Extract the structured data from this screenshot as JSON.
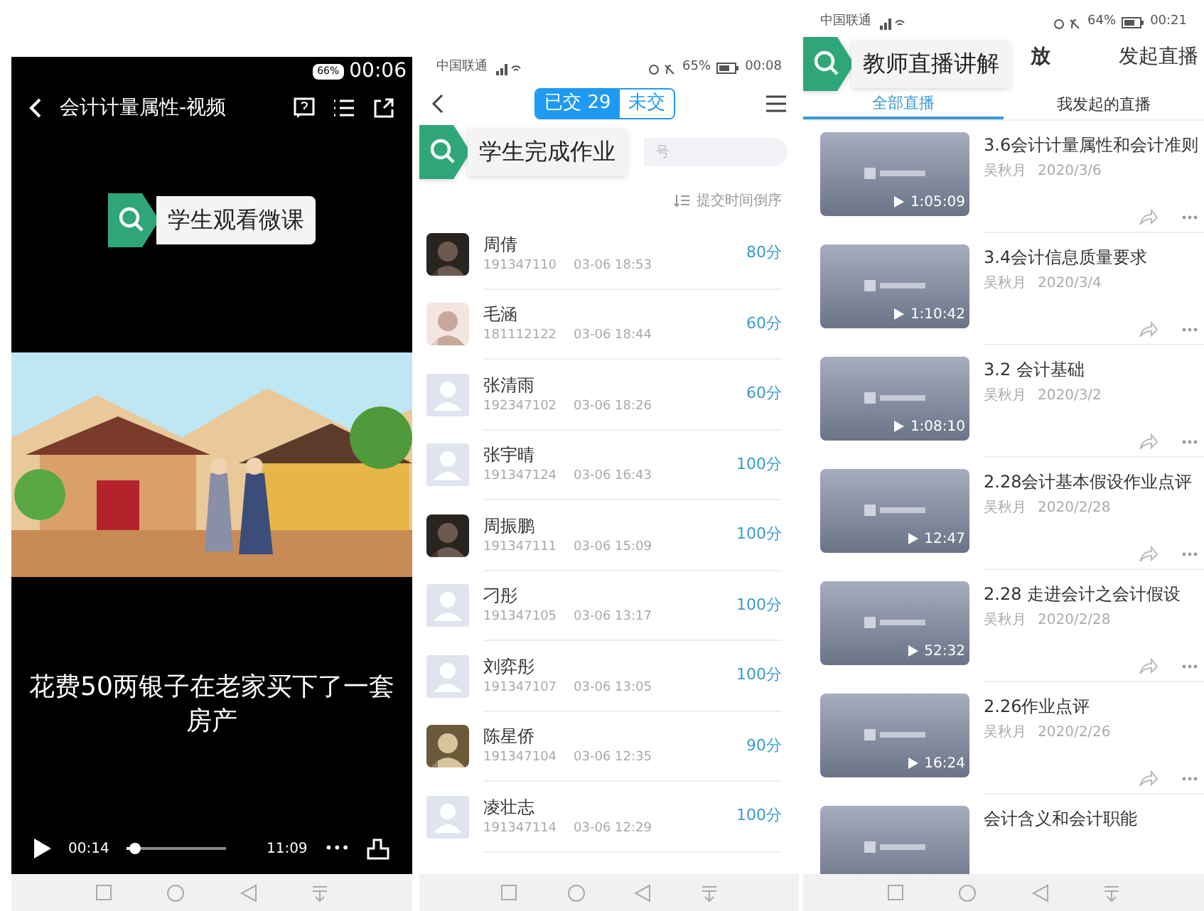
{
  "video_screen": {
    "status_bar": {
      "battery": "66%",
      "time": "00:06"
    },
    "title": "会计计量属性-视频",
    "callout": "学生观看微课",
    "subtitle": "花费50两银子在老家买下了一套房产",
    "player": {
      "elapsed": "00:14",
      "duration": "11:09",
      "level": 0.03,
      "more": "•••"
    }
  },
  "homework_screen": {
    "status_bar": {
      "carrier": "中国联通",
      "battery": "65%",
      "time": "00:08"
    },
    "segments": [
      {
        "label": "已交 29",
        "selected": true
      },
      {
        "label": "未交",
        "selected": false
      }
    ],
    "search": {
      "placeholder": "号"
    },
    "callout": "学生完成作业",
    "sort": "提交时间倒序",
    "rows": [
      {
        "name": "周倩",
        "id": "191347110",
        "time": "03-06 18:53",
        "score": "80分"
      },
      {
        "name": "毛涵",
        "id": "181112122",
        "time": "03-06 18:44",
        "score": "60分"
      },
      {
        "name": "张清雨",
        "id": "192347102",
        "time": "03-06 18:26",
        "score": "60分",
        "kind": "placeholder"
      },
      {
        "name": "张宇晴",
        "id": "191347124",
        "time": "03-06 16:43",
        "score": "100分",
        "kind": "placeholder"
      },
      {
        "name": "周振鹏",
        "id": "191347111",
        "time": "03-06 15:09",
        "score": "100分"
      },
      {
        "name": "刁彤",
        "id": "191347105",
        "time": "03-06 13:17",
        "score": "100分",
        "kind": "placeholder"
      },
      {
        "name": "刘弈彤",
        "id": "191347107",
        "time": "03-06 13:05",
        "score": "100分",
        "kind": "placeholder"
      },
      {
        "name": "陈星侨",
        "id": "191347104",
        "time": "03-06 12:35",
        "score": "90分"
      },
      {
        "name": "凌壮志",
        "id": "191347114",
        "time": "03-06 12:29",
        "score": "100分",
        "kind": "placeholder"
      }
    ]
  },
  "live_screen": {
    "status_bar": {
      "carrier": "中国联通",
      "battery": "64%",
      "time": "00:21"
    },
    "title_fragment": "放",
    "start_button": "发起直播",
    "callout": "教师直播讲解",
    "tabs": [
      {
        "label": "全部直播",
        "selected": true
      },
      {
        "label": "我发起的直播",
        "selected": false
      }
    ],
    "items": [
      {
        "title": "3.6会计计量属性和会计准则",
        "author": "吴秋月",
        "date": "2020/3/6",
        "duration": "1:05:09"
      },
      {
        "title": "3.4会计信息质量要求",
        "author": "吴秋月",
        "date": "2020/3/4",
        "duration": "1:10:42"
      },
      {
        "title": "3.2 会计基础",
        "author": "吴秋月",
        "date": "2020/3/2",
        "duration": "1:08:10"
      },
      {
        "title": "2.28会计基本假设作业点评",
        "author": "吴秋月",
        "date": "2020/2/28",
        "duration": "12:47"
      },
      {
        "title": "2.28 走进会计之会计假设",
        "author": "吴秋月",
        "date": "2020/2/28",
        "duration": "52:32"
      },
      {
        "title": "2.26作业点评",
        "author": "吴秋月",
        "date": "2020/2/26",
        "duration": "16:24"
      },
      {
        "title": "会计含义和会计职能"
      }
    ]
  }
}
